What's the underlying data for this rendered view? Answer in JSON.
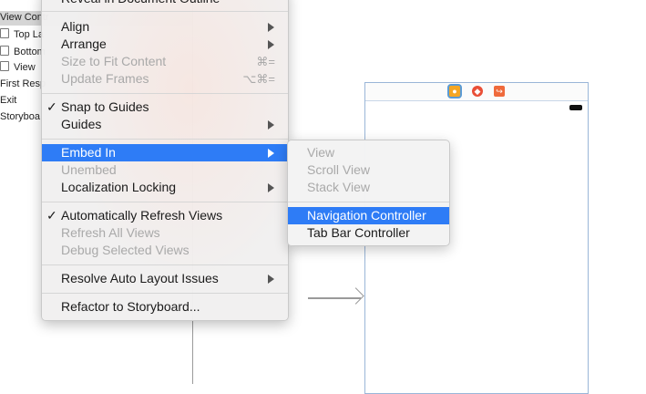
{
  "outline": {
    "rows": [
      {
        "label": "View Contr",
        "selected": true
      },
      {
        "label": "Top La",
        "box": true
      },
      {
        "label": "Bottom",
        "box": true
      },
      {
        "label": "View",
        "box": true
      },
      {
        "label": "First Resp"
      },
      {
        "label": "Exit"
      },
      {
        "label": "Storyboa"
      }
    ]
  },
  "context_menu": {
    "top_clipped_label": "Reveal in Document Outline",
    "align": "Align",
    "arrange": "Arrange",
    "size_to_fit": "Size to Fit Content",
    "size_to_fit_shortcut": "⌘=",
    "update_frames": "Update Frames",
    "update_frames_shortcut": "⌥⌘=",
    "snap_to_guides": "Snap to Guides",
    "guides": "Guides",
    "embed_in": "Embed In",
    "unembed": "Unembed",
    "localization_locking": "Localization Locking",
    "auto_refresh": "Automatically Refresh Views",
    "refresh_all": "Refresh All Views",
    "debug_selected": "Debug Selected Views",
    "resolve_auto_layout": "Resolve Auto Layout Issues",
    "refactor": "Refactor to Storyboard...",
    "check_mark": "✓"
  },
  "embed_submenu": {
    "view": "View",
    "scroll_view": "Scroll View",
    "stack_view": "Stack View",
    "navigation_controller": "Navigation Controller",
    "tab_bar_controller": "Tab Bar Controller"
  },
  "colors": {
    "highlight": "#2e7cf6",
    "disabled_text": "#a9a9a9",
    "scene_border": "#9ab6d8"
  }
}
